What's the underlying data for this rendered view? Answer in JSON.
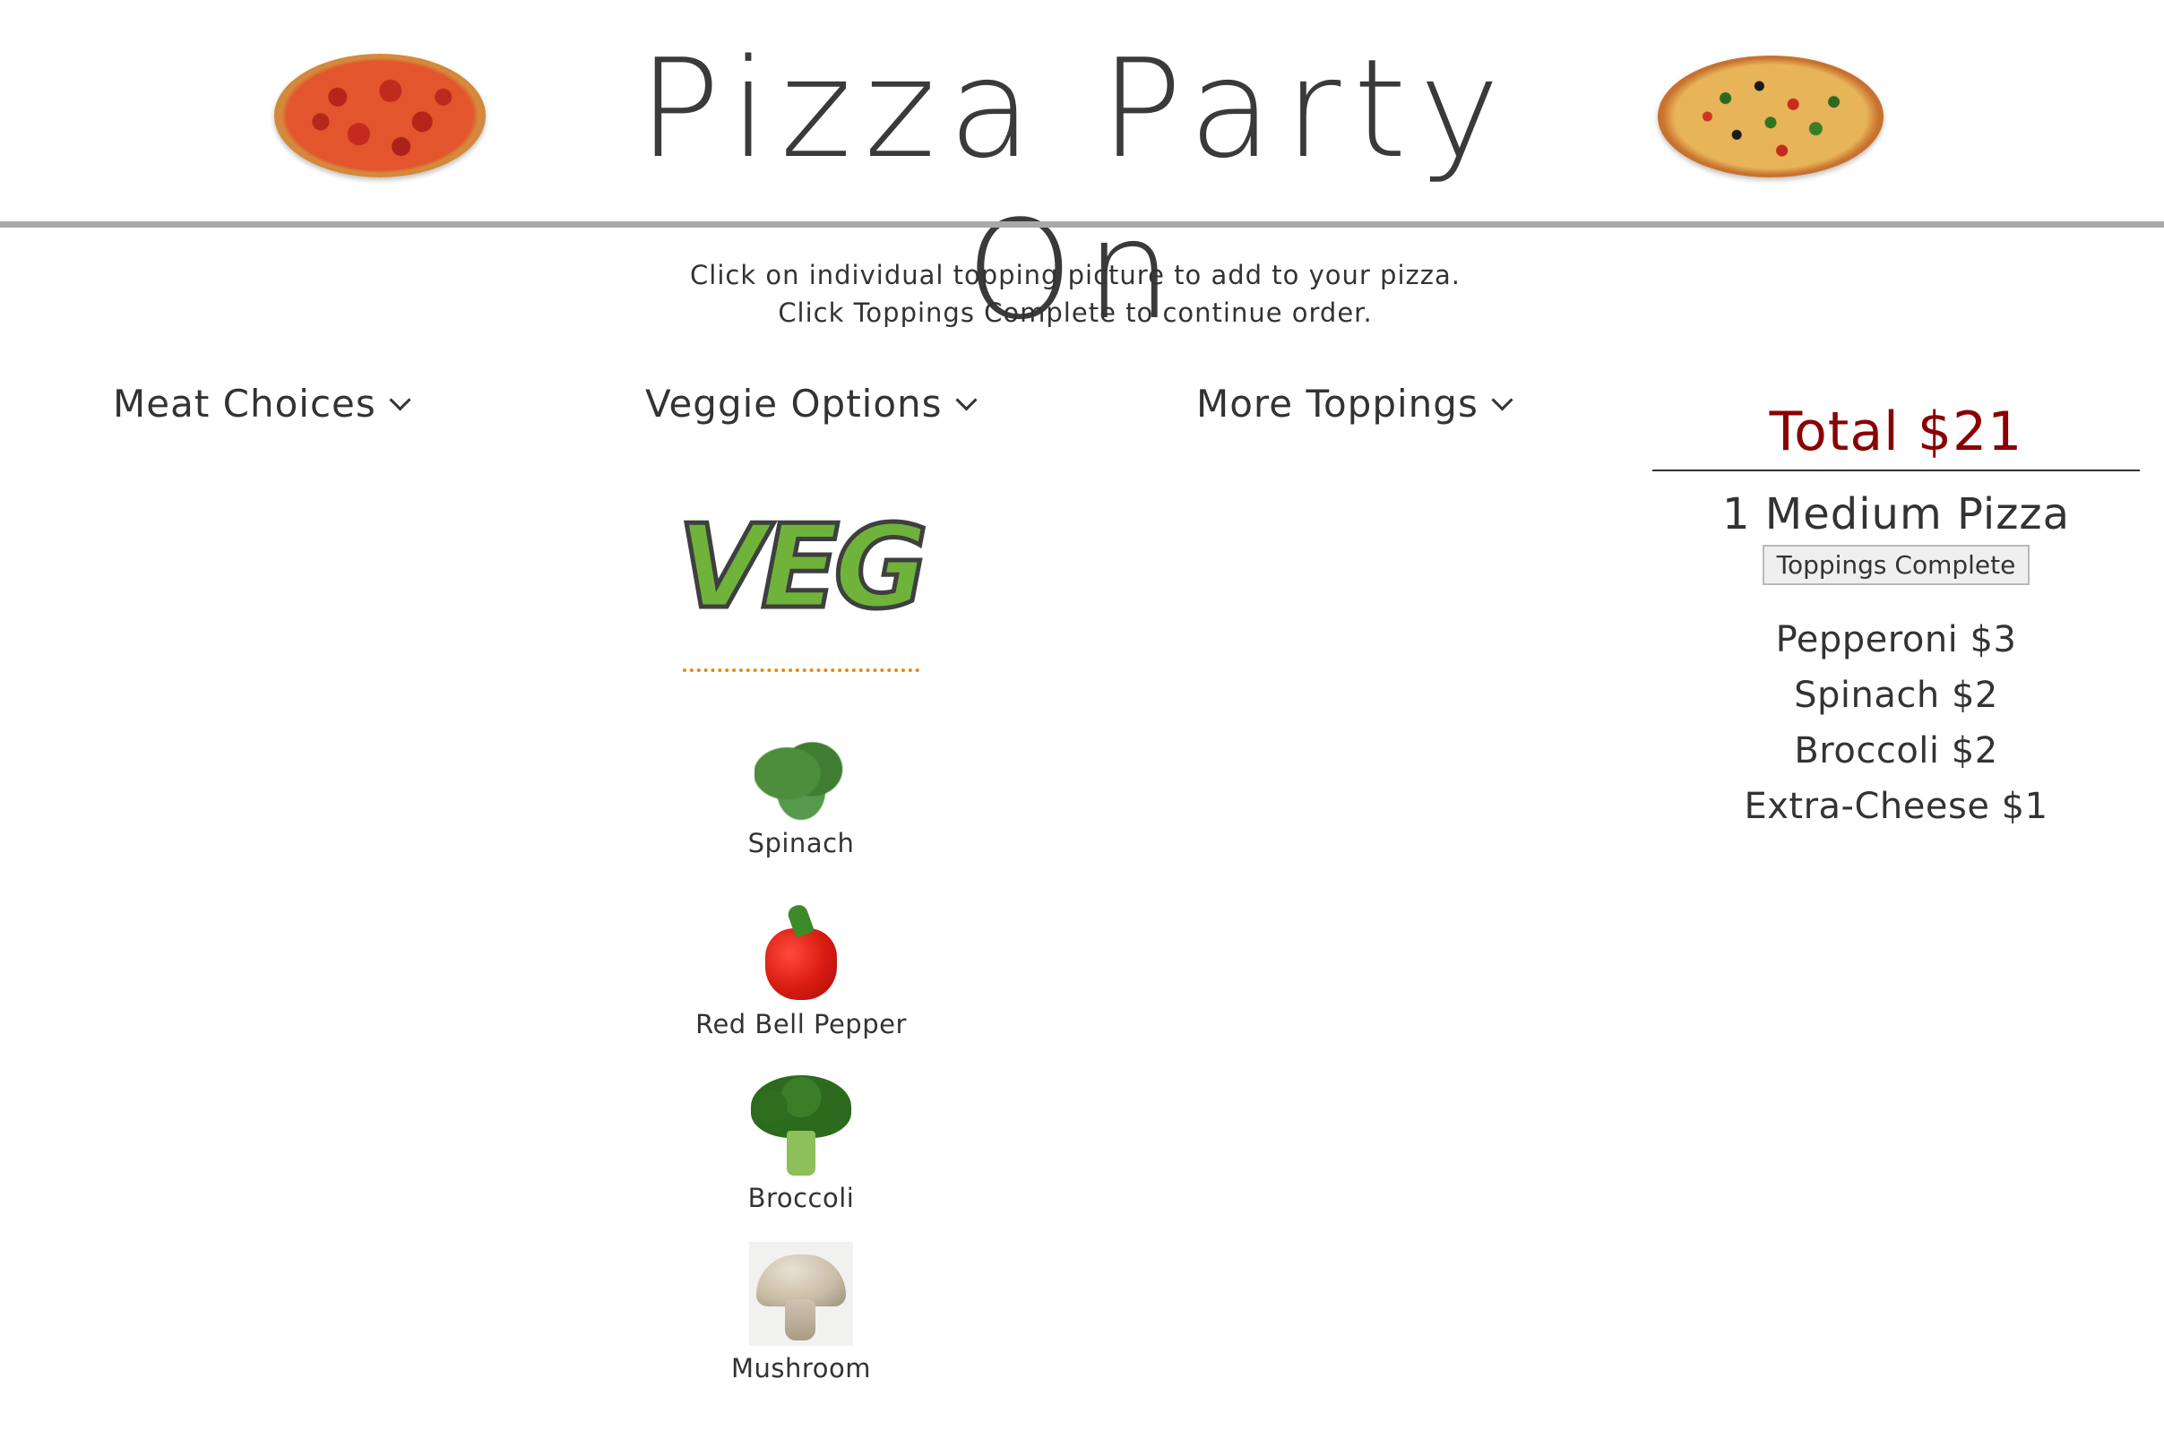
{
  "header": {
    "title": "Pizza Party On",
    "left_image": "pepperoni-pizza",
    "right_image": "veggie-pizza"
  },
  "instructions": {
    "line1": "Click on individual topping picture to add to your pizza.",
    "line2": "Click Toppings Complete to continue order."
  },
  "menus": {
    "meat": "Meat Choices",
    "veggie": "Veggie Options",
    "more": "More Toppings"
  },
  "veggie_section": {
    "logo_text": "VEG",
    "items": [
      {
        "label": "Spinach",
        "icon": "spinach-icon"
      },
      {
        "label": "Red Bell Pepper",
        "icon": "red-bell-pepper-icon"
      },
      {
        "label": "Broccoli",
        "icon": "broccoli-icon"
      },
      {
        "label": "Mushroom",
        "icon": "mushroom-icon"
      }
    ]
  },
  "order": {
    "total": "Total $21",
    "size": "1 Medium Pizza",
    "complete_button": "Toppings Complete",
    "toppings": [
      "Pepperoni $3",
      "Spinach $2",
      "Broccoli $2",
      "Extra-Cheese $1"
    ]
  },
  "colors": {
    "total": "#8b0000",
    "divider": "#e58a17",
    "header_rule": "#a9a9a9"
  }
}
